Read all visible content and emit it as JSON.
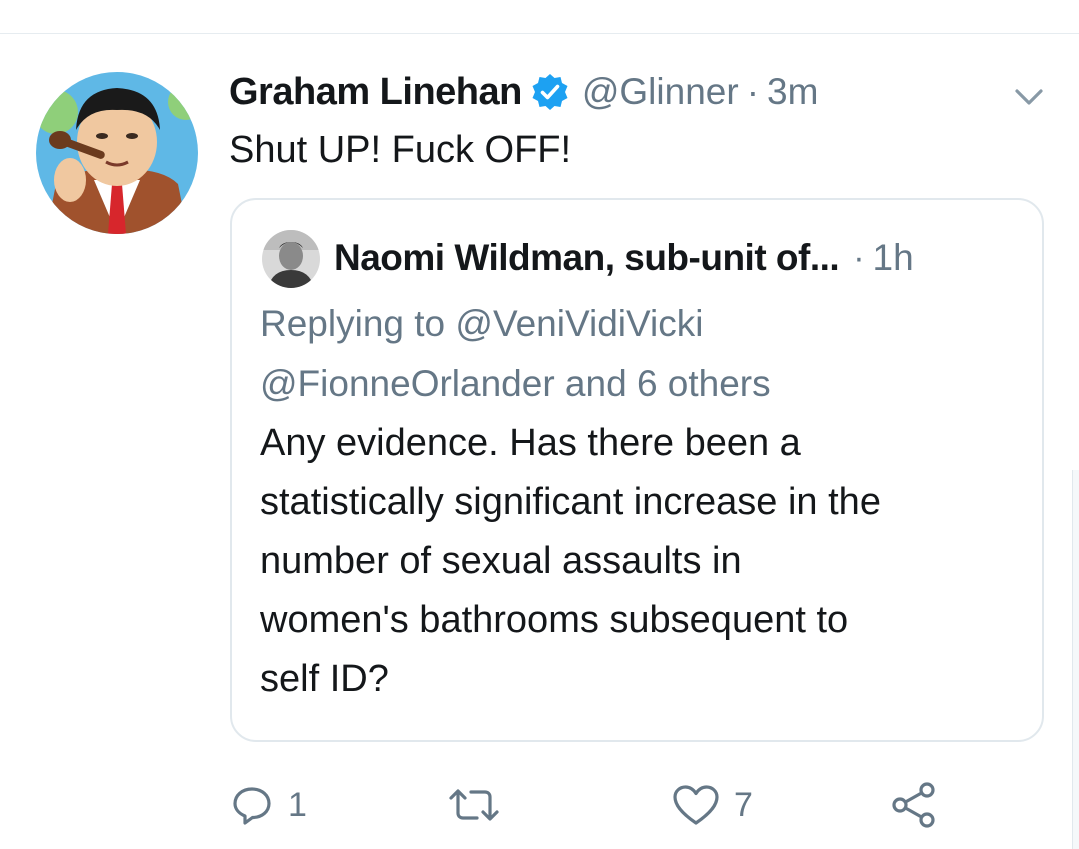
{
  "tweet": {
    "display_name": "Graham Linehan",
    "verified_icon": "verified-badge-icon",
    "handle": "@Glinner",
    "separator": "·",
    "time": "3m",
    "text": "Shut UP! Fuck OFF!",
    "menu_icon": "chevron-down-icon"
  },
  "quoted_tweet": {
    "display_name": "Naomi Wildman, sub-unit of...",
    "separator": "·",
    "time": "1h",
    "replying_line1": "Replying to @VeniVidiVicki",
    "replying_line2": "@FionneOrlander and 6 others",
    "body_lines": [
      "Any evidence. Has there been a",
      "statistically significant increase in the",
      "number of sexual assaults in",
      "women's bathrooms subsequent to",
      "self ID?"
    ]
  },
  "actions": {
    "reply": {
      "icon": "reply-icon",
      "count": "1"
    },
    "retweet": {
      "icon": "retweet-icon",
      "count": ""
    },
    "like": {
      "icon": "heart-icon",
      "count": "7"
    },
    "share": {
      "icon": "share-icon",
      "count": ""
    }
  },
  "colors": {
    "text_primary": "#14171a",
    "text_secondary": "#657786",
    "verified_blue": "#1da1f2",
    "border": "#e1e8ed"
  }
}
